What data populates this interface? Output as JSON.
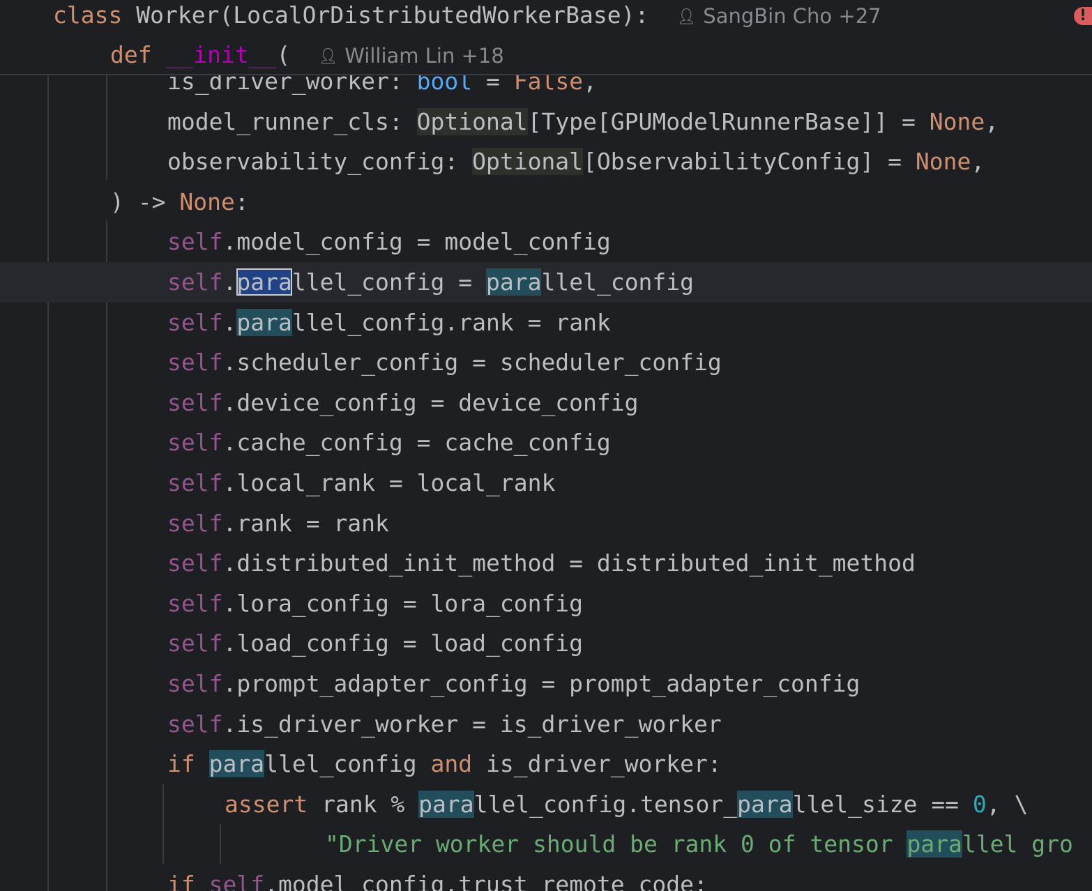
{
  "sticky_header": {
    "class_line": {
      "keyword": "class",
      "name": "Worker",
      "base": "(LocalOrDistributedWorkerBase):",
      "author": "SangBin Cho +27"
    },
    "def_line": {
      "keyword": "def",
      "name": "__init__",
      "paren": "(",
      "author": "William Lin +18"
    },
    "error_indicator": "!"
  },
  "code": {
    "l0": {
      "a": "is_driver_worker: ",
      "b": "bool",
      "c": " = ",
      "d": "False",
      "e": ","
    },
    "l1": {
      "a": "model_runner_cls: ",
      "b": "Optional",
      "c": "[Type[GPUModelRunnerBase]] = ",
      "d": "None",
      "e": ","
    },
    "l2": {
      "a": "observability_config: ",
      "b": "Optional",
      "c": "[ObservabilityConfig] = ",
      "d": "None",
      "e": ","
    },
    "l3": {
      "a": ") -> ",
      "b": "None",
      "c": ":"
    },
    "l4": {
      "self": "self",
      "rest": ".model_config = model_config"
    },
    "l5": {
      "self": "self",
      "dot": ".",
      "h1": "para",
      "m": "llel_config = ",
      "h2": "para",
      "e": "llel_config"
    },
    "l6": {
      "self": "self",
      "dot": ".",
      "h1": "para",
      "e": "llel_config.rank = rank"
    },
    "l7": {
      "self": "self",
      "rest": ".scheduler_config = scheduler_config"
    },
    "l8": {
      "self": "self",
      "rest": ".device_config = device_config"
    },
    "l9": {
      "self": "self",
      "rest": ".cache_config = cache_config"
    },
    "l10": {
      "self": "self",
      "rest": ".local_rank = local_rank"
    },
    "l11": {
      "self": "self",
      "rest": ".rank = rank"
    },
    "l12": {
      "self": "self",
      "rest": ".distributed_init_method = distributed_init_method"
    },
    "l13": {
      "self": "self",
      "rest": ".lora_config = lora_config"
    },
    "l14": {
      "self": "self",
      "rest": ".load_config = load_config"
    },
    "l15": {
      "self": "self",
      "rest": ".prompt_adapter_config = prompt_adapter_config"
    },
    "l16": {
      "self": "self",
      "rest": ".is_driver_worker = is_driver_worker"
    },
    "l17": {
      "kw": "if",
      "sp": " ",
      "h1": "para",
      "m": "llel_config ",
      "and": "and",
      "e": " is_driver_worker:"
    },
    "l18": {
      "kw": "assert",
      "a": " rank % ",
      "h1": "para",
      "b": "llel_config.tensor_",
      "h2": "para",
      "c": "llel_size == ",
      "num": "0",
      "e": ", \\"
    },
    "l19": {
      "s1": "\"Driver worker should be rank 0 of tensor ",
      "h1": "para",
      "s2": "llel gro"
    },
    "l20": {
      "kw": "if",
      "sp": " ",
      "self": "self",
      "rest": ".model_config.trust_remote_code:"
    }
  }
}
